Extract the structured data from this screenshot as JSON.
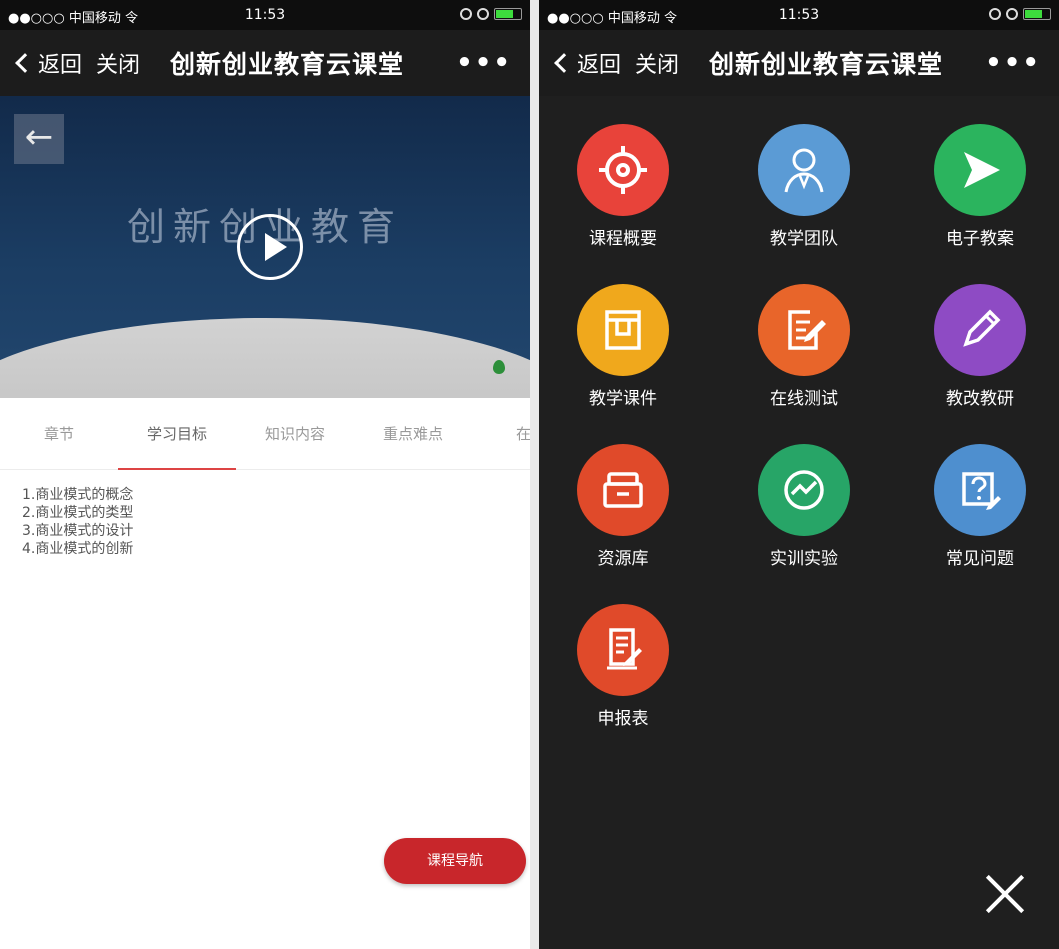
{
  "status": {
    "carrier": "●●○○○ 中国移动 令",
    "time": "11:53"
  },
  "nav": {
    "back_label": "返回",
    "close_label": "关闭",
    "title": "创新创业教育云课堂",
    "more": "•••"
  },
  "video": {
    "title": "创新创业教育"
  },
  "tabs": [
    "章节",
    "学习目标",
    "知识内容",
    "重点难点",
    "在线"
  ],
  "goals": [
    "1.商业模式的概念",
    "2.商业模式的类型",
    "3.商业模式的设计",
    "4.商业模式的创新"
  ],
  "course_nav_button": "课程导航",
  "menu": {
    "items": [
      {
        "label": "课程概要",
        "icon": "target-icon",
        "color": "#e8433a"
      },
      {
        "label": "教学团队",
        "icon": "teacher-icon",
        "color": "#5b9bd5"
      },
      {
        "label": "电子教案",
        "icon": "send-icon",
        "color": "#2bb45e"
      },
      {
        "label": "教学课件",
        "icon": "courseware-icon",
        "color": "#f0a81c"
      },
      {
        "label": "在线测试",
        "icon": "test-icon",
        "color": "#e8652a"
      },
      {
        "label": "教改教研",
        "icon": "pencil-icon",
        "color": "#8e4bc4"
      },
      {
        "label": "资源库",
        "icon": "archive-icon",
        "color": "#e04a2a"
      },
      {
        "label": "实训实验",
        "icon": "trend-icon",
        "color": "#27a567"
      },
      {
        "label": "常见问题",
        "icon": "question-icon",
        "color": "#4e8fcf"
      },
      {
        "label": "申报表",
        "icon": "form-icon",
        "color": "#e04a2a"
      }
    ]
  }
}
